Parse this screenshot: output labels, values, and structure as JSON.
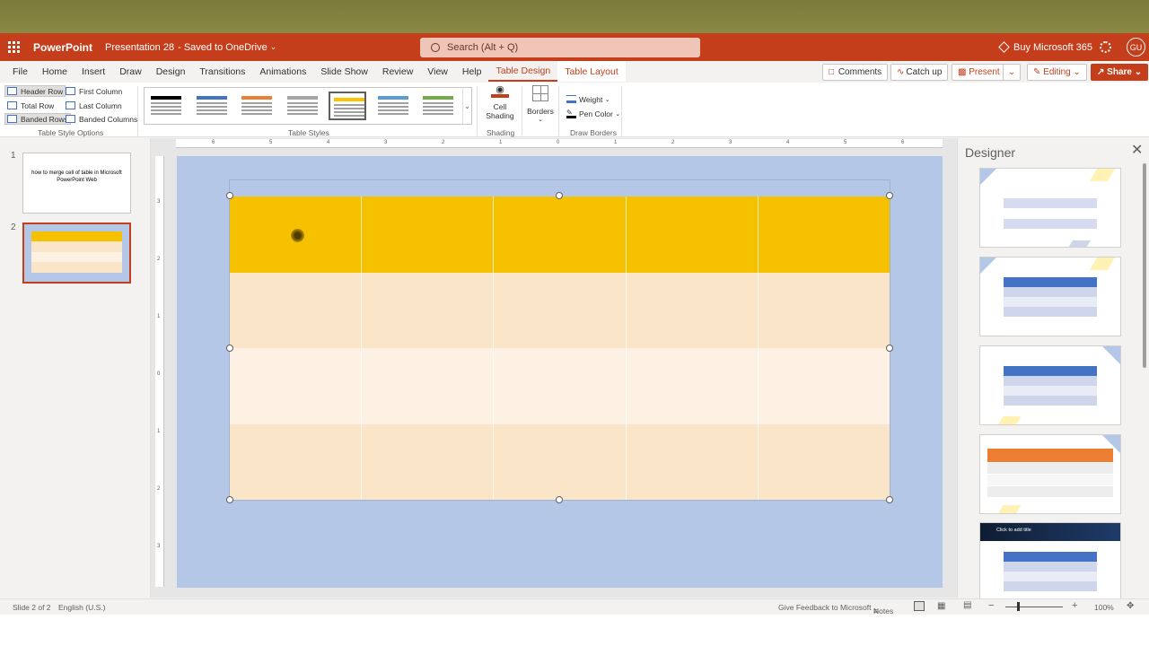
{
  "app": {
    "name": "PowerPoint",
    "doc_name": "Presentation 28",
    "doc_status": "Saved to OneDrive",
    "search_placeholder": "Search (Alt + Q)",
    "buy_label": "Buy Microsoft 365",
    "avatar_initials": "GU",
    "brand_color": "#c43e1c"
  },
  "tabs": [
    "File",
    "Home",
    "Insert",
    "Draw",
    "Design",
    "Transitions",
    "Animations",
    "Slide Show",
    "Review",
    "View",
    "Help",
    "Table Design",
    "Table Layout"
  ],
  "active_tab": "Table Design",
  "top_actions": {
    "comments": "Comments",
    "catch_up": "Catch up",
    "present": "Present",
    "editing": "Editing",
    "share": "Share"
  },
  "ribbon": {
    "options": {
      "header_row": "Header Row",
      "total_row": "Total Row",
      "banded_rows": "Banded Rows",
      "first_column": "First Column",
      "last_column": "Last Column",
      "banded_columns": "Banded Columns",
      "group_label": "Table Style Options"
    },
    "styles_label": "Table Styles",
    "cell_shading": "Cell Shading",
    "shading_label": "Shading",
    "borders": "Borders",
    "weight": "Weight",
    "pen_color": "Pen Color",
    "draw_borders_label": "Draw Borders",
    "style_colors": [
      "#000000",
      "#4472c4",
      "#ed7d31",
      "#a5a5a5",
      "#ffc000",
      "#5b9bd5",
      "#70ad47"
    ]
  },
  "slides": {
    "slide1_text": "how to merge cell of table in Microsoft PowerPoint Web",
    "numbers": [
      "1",
      "2"
    ]
  },
  "ruler": {
    "h_ticks": [
      "6",
      "5",
      "4",
      "3",
      "2",
      "1",
      "0",
      "1",
      "2",
      "3",
      "4",
      "5",
      "6"
    ],
    "v_ticks": [
      "3",
      "2",
      "1",
      "0",
      "1",
      "2",
      "3"
    ]
  },
  "table": {
    "header_color": "#f6c100",
    "row_colors": [
      "#fbe5c8",
      "#fdf1e3",
      "#fbe5c8"
    ],
    "columns": 5
  },
  "designer": {
    "title": "Designer",
    "card5_title": "Click to add title"
  },
  "status": {
    "slide_info": "Slide 2 of 2",
    "language": "English (U.S.)",
    "feedback": "Give Feedback to Microsoft",
    "notes": "Notes",
    "zoom": "100%"
  }
}
